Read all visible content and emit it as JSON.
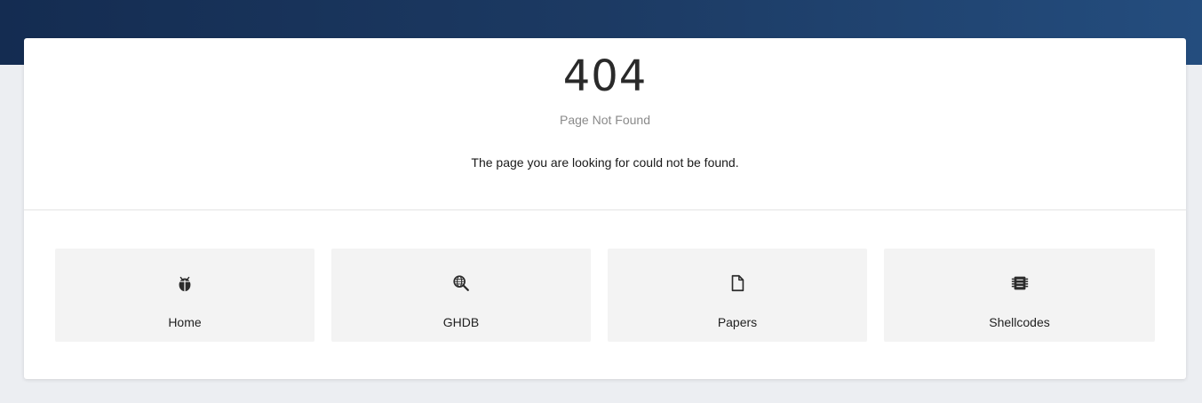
{
  "error": {
    "code": "404",
    "title": "Page Not Found",
    "message": "The page you are looking for could not be found."
  },
  "links": [
    {
      "label": "Home",
      "icon": "bug-icon"
    },
    {
      "label": "GHDB",
      "icon": "globe-search-icon"
    },
    {
      "label": "Papers",
      "icon": "document-icon"
    },
    {
      "label": "Shellcodes",
      "icon": "chip-icon"
    }
  ],
  "colors": {
    "banner_start": "#142c51",
    "banner_end": "#244d7e",
    "tile_background": "#f3f3f3",
    "page_background": "#eceef2"
  }
}
